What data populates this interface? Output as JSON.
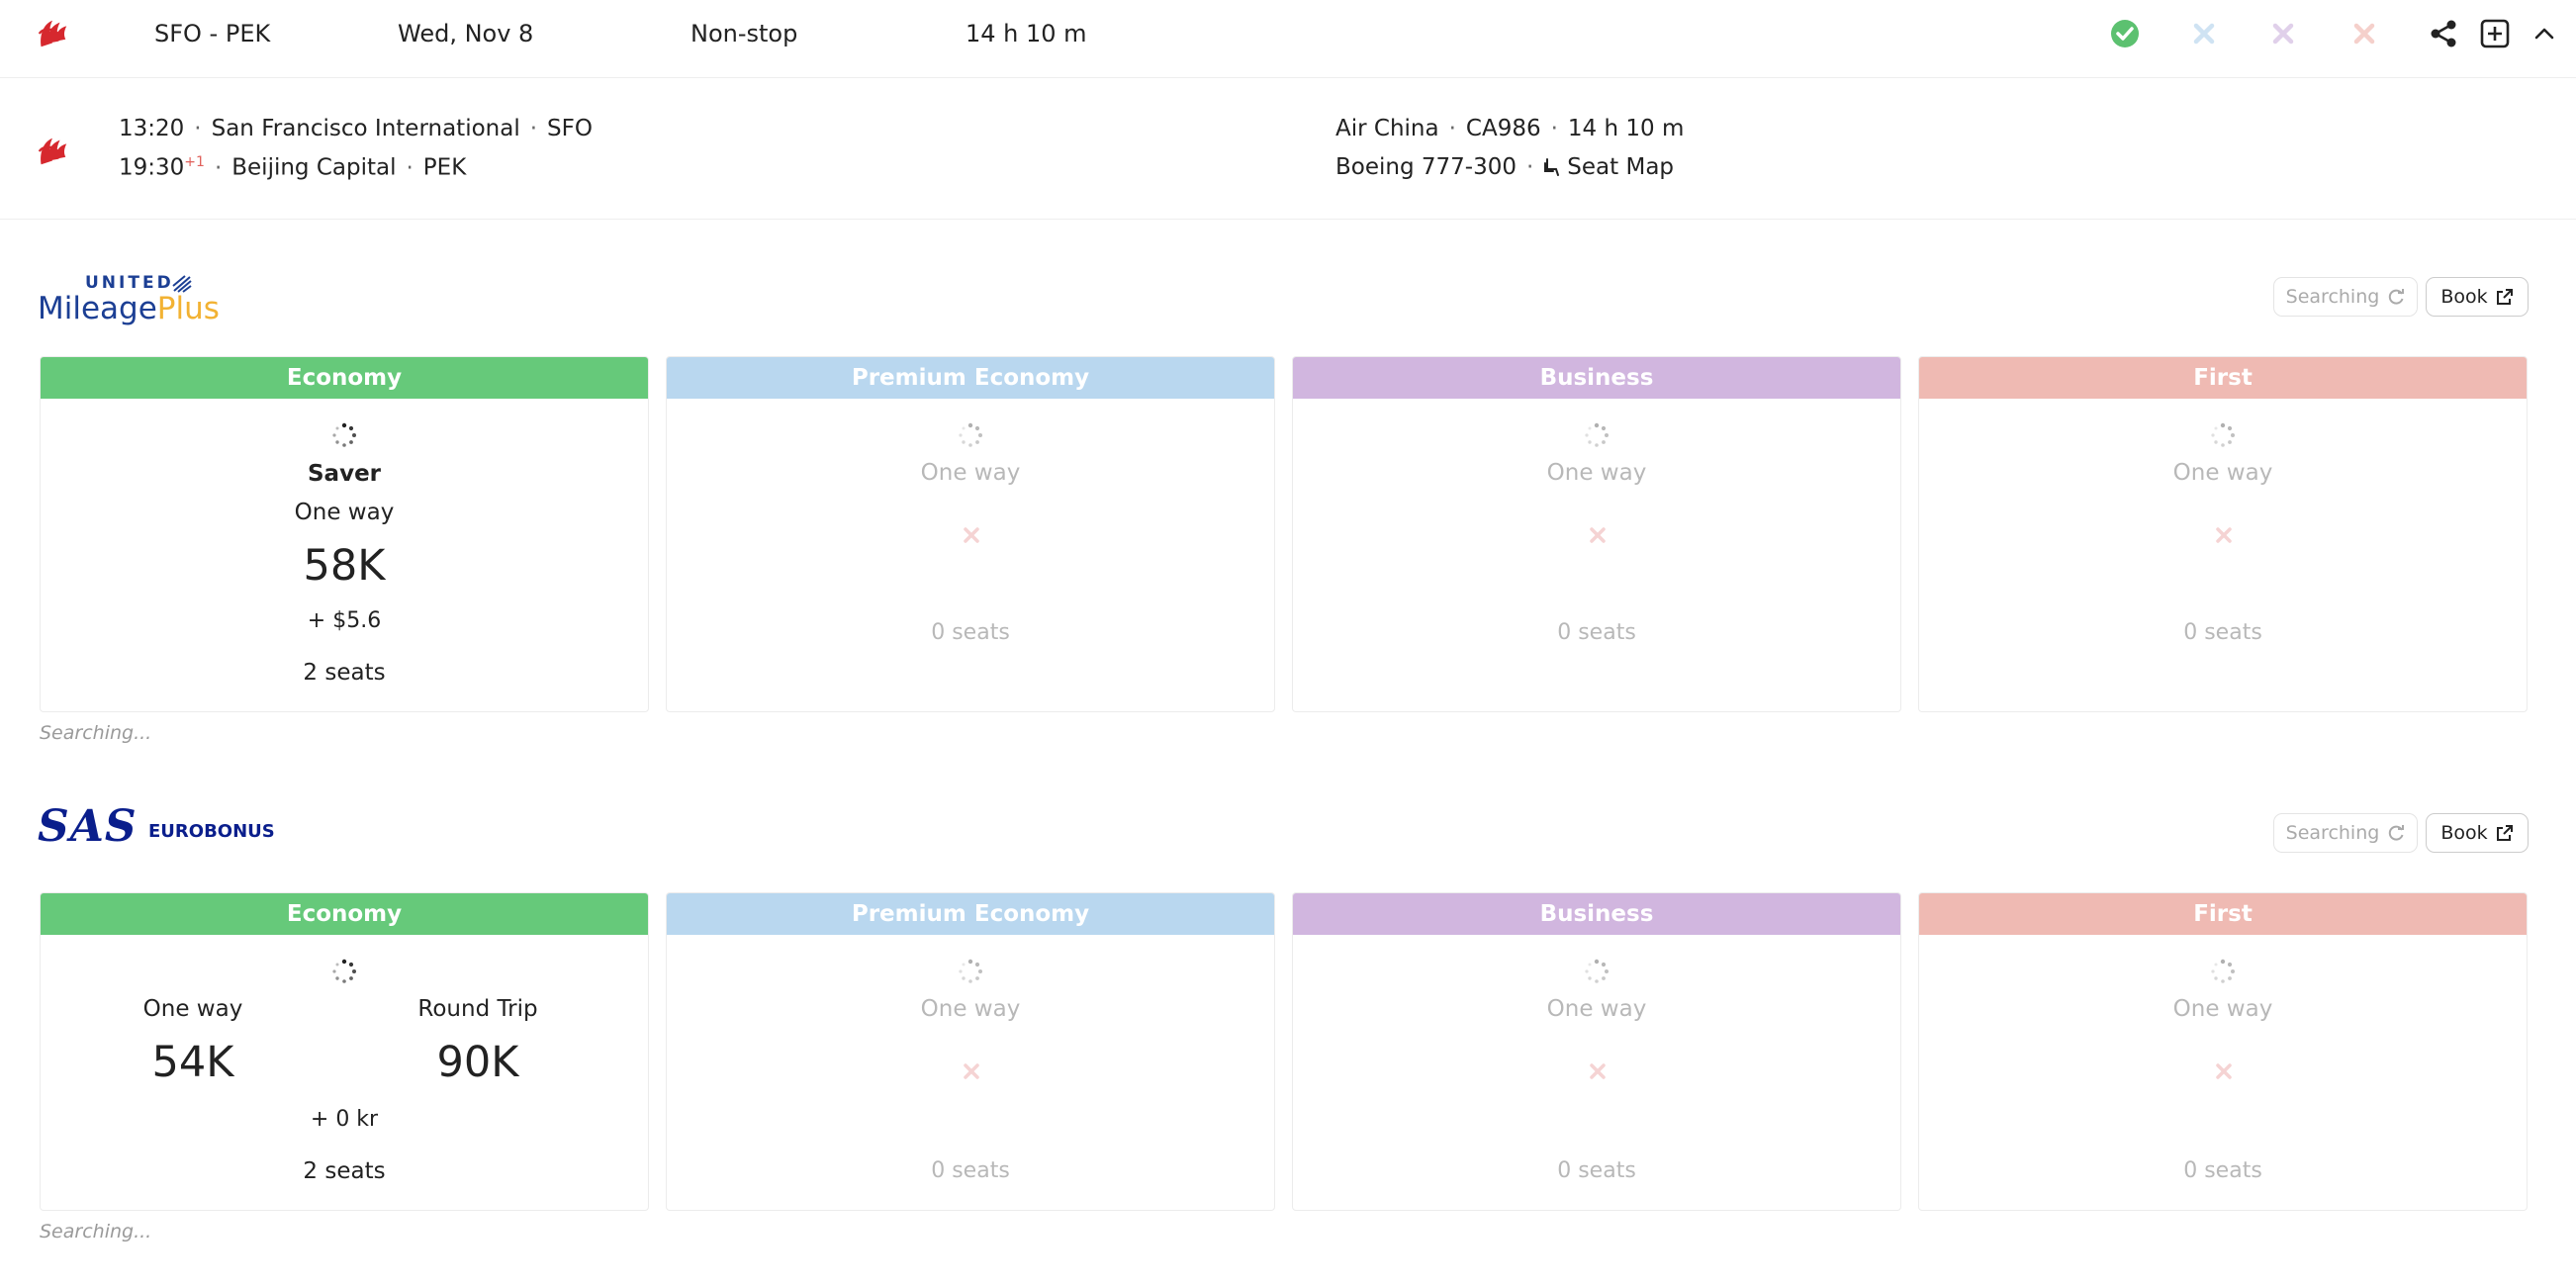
{
  "topbar": {
    "route": "SFO - PEK",
    "date": "Wed, Nov 8",
    "stops": "Non-stop",
    "duration": "14 h 10 m"
  },
  "flight": {
    "depart_time": "13:20",
    "depart_airport": "San Francisco International",
    "depart_code": "SFO",
    "arrive_time": "19:30",
    "arrive_day_offset": "+1",
    "arrive_airport": "Beijing Capital",
    "arrive_code": "PEK",
    "airline": "Air China",
    "flight_no": "CA986",
    "flight_duration": "14 h 10 m",
    "aircraft": "Boeing 777-300",
    "seat_map_label": "Seat Map"
  },
  "programs": [
    {
      "logo_top": "UNITED",
      "logo_main": "Mileage",
      "logo_accent": "Plus",
      "searching_label": "Searching",
      "book_label": "Book",
      "footer_note": "Searching...",
      "cabins": [
        {
          "name": "Economy",
          "fare": "Saver",
          "trip": "One way",
          "miles": "58K",
          "tax": "+ $5.6",
          "seats": "2 seats"
        },
        {
          "name": "Premium Economy",
          "trip": "One way",
          "seats": "0 seats"
        },
        {
          "name": "Business",
          "trip": "One way",
          "seats": "0 seats"
        },
        {
          "name": "First",
          "trip": "One way",
          "seats": "0 seats"
        }
      ]
    },
    {
      "logo_main": "SAS",
      "logo_sub": "EUROBONUS",
      "searching_label": "Searching",
      "book_label": "Book",
      "footer_note": "Searching...",
      "cabins": [
        {
          "name": "Economy",
          "trip_a": "One way",
          "miles_a": "54K",
          "trip_b": "Round Trip",
          "miles_b": "90K",
          "tax": "+ 0 kr",
          "seats": "2 seats"
        },
        {
          "name": "Premium Economy",
          "trip": "One way",
          "seats": "0 seats"
        },
        {
          "name": "Business",
          "trip": "One way",
          "seats": "0 seats"
        },
        {
          "name": "First",
          "trip": "One way",
          "seats": "0 seats"
        }
      ]
    }
  ],
  "colors": {
    "economy": "#66c97a",
    "premium": "#b9d7ef",
    "business": "#d1b6df",
    "first": "#efbab3",
    "success": "#5cc170",
    "air_china_red": "#d6282e",
    "united_blue": "#1c3f94",
    "united_gold": "#f2b233",
    "sas_blue": "#0a1e8c"
  }
}
